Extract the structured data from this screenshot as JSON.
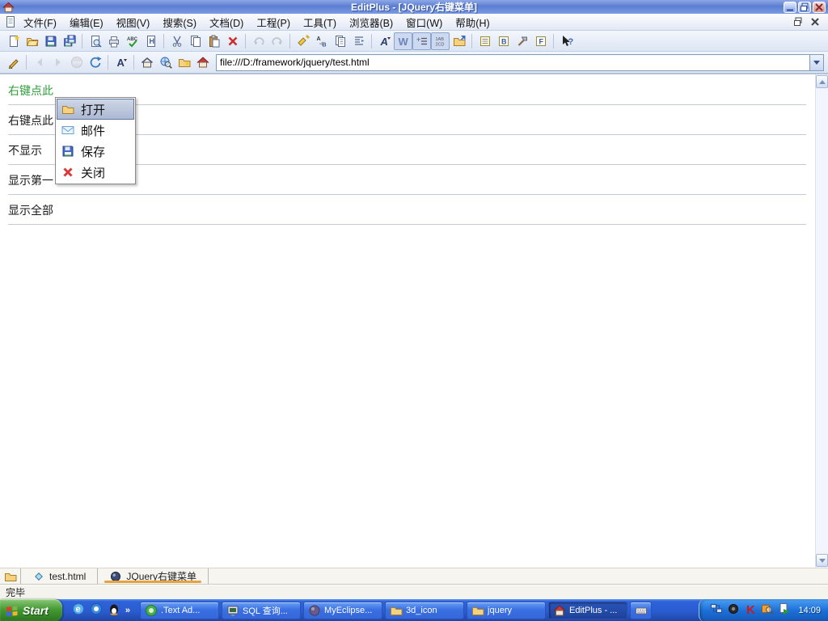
{
  "window": {
    "title": "EditPlus - [JQuery右键菜单]",
    "controls": [
      "minimize-icon",
      "restore-icon",
      "close-icon"
    ]
  },
  "menu_bar": {
    "items": [
      {
        "label": "文件(F)"
      },
      {
        "label": "编辑(E)"
      },
      {
        "label": "视图(V)"
      },
      {
        "label": "搜索(S)"
      },
      {
        "label": "文档(D)"
      },
      {
        "label": "工程(P)"
      },
      {
        "label": "工具(T)"
      },
      {
        "label": "浏览器(B)"
      },
      {
        "label": "窗口(W)"
      },
      {
        "label": "帮助(H)"
      }
    ],
    "window_controls": [
      "minimize-icon",
      "restore-icon",
      "close-icon"
    ]
  },
  "toolbar": {
    "buttons": [
      {
        "icon": "new-file-icon"
      },
      {
        "icon": "open-folder-icon"
      },
      {
        "icon": "save-icon"
      },
      {
        "icon": "save-all-icon"
      },
      {
        "sep": true
      },
      {
        "icon": "print-preview-icon"
      },
      {
        "icon": "print-icon"
      },
      {
        "icon": "spell-check-icon"
      },
      {
        "icon": "html-doc-icon"
      },
      {
        "sep": true
      },
      {
        "icon": "cut-icon"
      },
      {
        "icon": "copy-icon"
      },
      {
        "icon": "paste-icon"
      },
      {
        "icon": "delete-icon"
      },
      {
        "sep": true
      },
      {
        "icon": "undo-icon",
        "disabled": true
      },
      {
        "icon": "redo-icon",
        "disabled": true
      },
      {
        "sep": true
      },
      {
        "icon": "find-icon"
      },
      {
        "icon": "replace-icon"
      },
      {
        "icon": "copy-block-icon"
      },
      {
        "icon": "indent-icon"
      },
      {
        "sep": true
      },
      {
        "icon": "font-icon"
      },
      {
        "icon": "word-wrap-icon",
        "pressed": true
      },
      {
        "icon": "line-numbers-icon",
        "pressed": true
      },
      {
        "icon": "ruler-icon",
        "pressed": true
      },
      {
        "icon": "open-html-icon"
      },
      {
        "sep": true
      },
      {
        "icon": "doc-list-icon"
      },
      {
        "icon": "tag-list-icon"
      },
      {
        "icon": "tools-hammer-icon"
      },
      {
        "icon": "function-list-icon"
      },
      {
        "sep": true
      },
      {
        "icon": "context-help-icon"
      }
    ]
  },
  "browser_bar": {
    "buttons": [
      {
        "icon": "edit-pencil-icon"
      },
      {
        "sep": true
      },
      {
        "icon": "back-icon",
        "disabled": true
      },
      {
        "icon": "forward-icon",
        "disabled": true
      },
      {
        "icon": "stop-icon",
        "disabled": true
      },
      {
        "icon": "refresh-icon"
      },
      {
        "sep": true
      },
      {
        "icon": "text-size-icon"
      },
      {
        "sep": true
      },
      {
        "icon": "home-icon"
      },
      {
        "icon": "search-globe-icon"
      },
      {
        "icon": "favorites-icon"
      },
      {
        "icon": "browser-app-icon"
      }
    ],
    "address": {
      "value": "file:///D:/framework/jquery/test.html"
    }
  },
  "content": {
    "rows": [
      {
        "text": "右键点此",
        "color": "green"
      },
      {
        "text": "右键点此",
        "color": "black"
      },
      {
        "text": "不显示",
        "color": "black"
      },
      {
        "text": "显示第一",
        "color": "black"
      },
      {
        "text": "显示全部",
        "color": "black"
      }
    ],
    "context_menu": {
      "items": [
        {
          "label": "打开",
          "icon": "folder-icon",
          "selected": true
        },
        {
          "label": "邮件",
          "icon": "mail-icon",
          "selected": false
        },
        {
          "label": "保存",
          "icon": "floppy-icon",
          "selected": false
        },
        {
          "label": "关闭",
          "icon": "close-red-icon",
          "selected": false
        }
      ]
    }
  },
  "tab_bar": {
    "tabs": [
      {
        "label": "test.html",
        "icon": "diamond-icon",
        "active": false
      },
      {
        "label": "JQuery右键菜单",
        "icon": "sphere-icon",
        "active": true
      }
    ]
  },
  "status_bar": {
    "text": "完毕"
  },
  "taskbar": {
    "start_label": "Start",
    "quick_launch": [
      "ie-icon",
      "messenger-icon",
      "qq-icon"
    ],
    "overflow_chevron": "»",
    "tasks": [
      {
        "label": ".Text Ad...",
        "icon": "green-app-icon"
      },
      {
        "label": "SQL 查询...",
        "icon": "sql-app-icon"
      },
      {
        "label": "MyEclipse...",
        "icon": "eclipse-app-icon"
      },
      {
        "label": "3d_icon",
        "icon": "folder-icon"
      },
      {
        "label": "jquery",
        "icon": "folder-icon"
      },
      {
        "label": "EditPlus - ...",
        "icon": "editplus-icon",
        "active": true
      },
      {
        "label": "",
        "icon": "keyboard-icon",
        "narrow": true
      }
    ],
    "tray": {
      "icons": [
        "network-icon",
        "speaker-icon",
        "kaspersky-icon",
        "search-tray-icon",
        "media-icon"
      ],
      "clock": "14:09"
    }
  },
  "colors": {
    "titlebar_blue": "#5b7ed3",
    "taskbar_blue": "#2a5cd0",
    "start_green": "#3d8f2e",
    "active_tab_underline": "#e8a23c",
    "green_text": "#2f9e3a",
    "menu_highlight": "#b9c3da"
  }
}
